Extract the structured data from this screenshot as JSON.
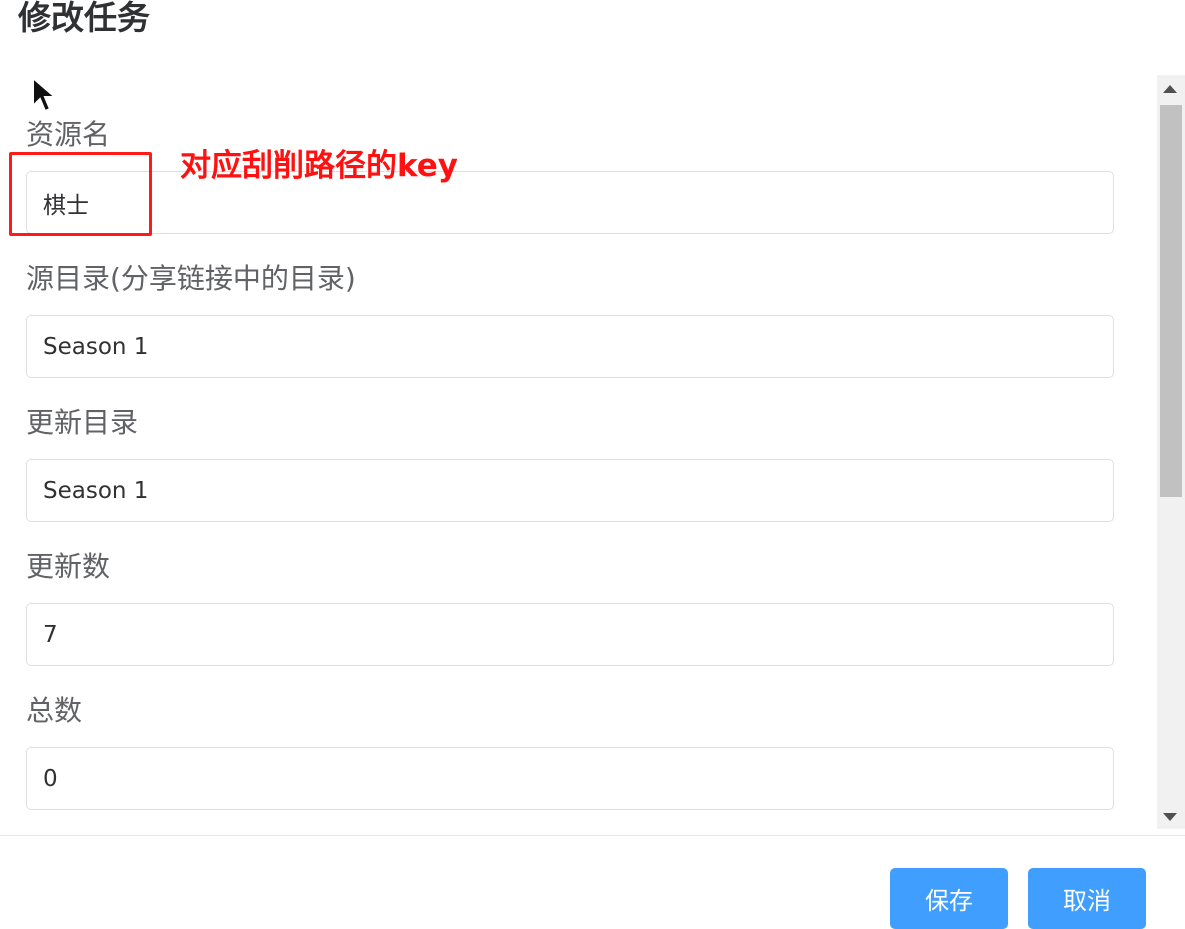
{
  "dialog": {
    "title": "修改任务"
  },
  "fields": [
    {
      "label": "资源名",
      "value": "棋士"
    },
    {
      "label": "源目录(分享链接中的目录)",
      "value": "Season 1"
    },
    {
      "label": "更新目录",
      "value": "Season 1"
    },
    {
      "label": "更新数",
      "value": "7"
    },
    {
      "label": "总数",
      "value": "0"
    }
  ],
  "annotation": {
    "text": "对应刮削路径的key",
    "color": "#ff1111"
  },
  "footer": {
    "save_label": "保存",
    "cancel_label": "取消"
  },
  "colors": {
    "primary": "#409eff",
    "label": "#606266",
    "border": "#dcdfe6"
  }
}
